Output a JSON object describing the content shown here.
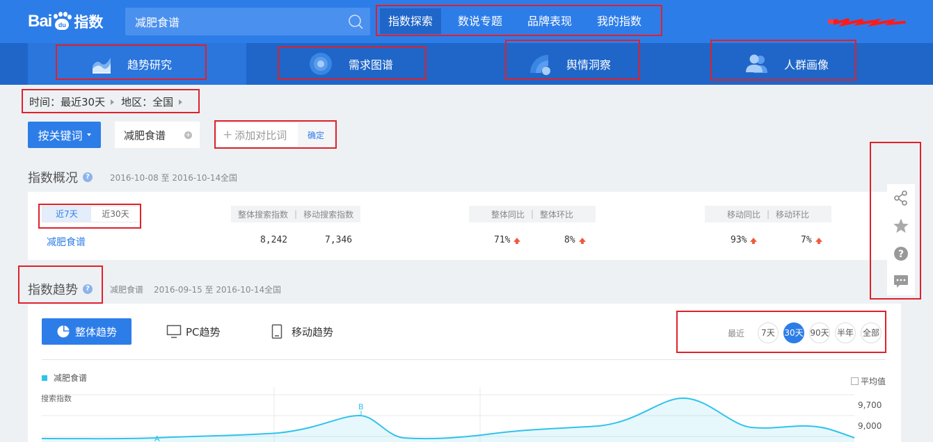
{
  "header": {
    "logo_bai": "Bai",
    "logo_du": "du",
    "logo_zh": "指数",
    "search_value": "减肥食谱",
    "nav": [
      {
        "label": "指数探索",
        "active": true
      },
      {
        "label": "数说专题",
        "active": false
      },
      {
        "label": "品牌表现",
        "active": false
      },
      {
        "label": "我的指数",
        "active": false
      }
    ]
  },
  "subnav": [
    {
      "label": "趋势研究",
      "icon": "trend-chart-icon",
      "active": true
    },
    {
      "label": "需求图谱",
      "icon": "target-circle-icon",
      "active": false
    },
    {
      "label": "舆情洞察",
      "icon": "signal-wave-icon",
      "active": false
    },
    {
      "label": "人群画像",
      "icon": "people-icon",
      "active": false
    }
  ],
  "filter": {
    "time_label": "时间：",
    "time_value": "最近30天",
    "region_label": "地区：",
    "region_value": "全国"
  },
  "keyword": {
    "mode_label": "按关键词",
    "tag": "减肥食谱",
    "add_compare": "添加对比词",
    "confirm": "确定"
  },
  "overview": {
    "title": "指数概况",
    "date_range": "2016-10-08 至 2016-10-14",
    "region": "全国",
    "range_tabs": [
      {
        "label": "近7天",
        "active": true
      },
      {
        "label": "近30天",
        "active": false
      }
    ],
    "col_search": [
      "整体搜索指数",
      "移动搜索指数"
    ],
    "col_yoy": [
      "整体同比",
      "整体环比"
    ],
    "col_mobile": [
      "移动同比",
      "移动环比"
    ],
    "row": {
      "keyword": "减肥食谱",
      "total_search": "8,242",
      "mobile_search": "7,346",
      "total_yoy": "71%",
      "total_mom": "8%",
      "mobile_yoy": "93%",
      "mobile_mom": "7%"
    }
  },
  "trend": {
    "title": "指数趋势",
    "keyword": "减肥食谱",
    "date_range": "2016-09-15 至 2016-10-14",
    "region": "全国",
    "tabs": [
      {
        "label": "整体趋势",
        "active": true
      },
      {
        "label": "PC趋势",
        "active": false
      },
      {
        "label": "移动趋势",
        "active": false
      }
    ],
    "period_label": "最近",
    "periods": [
      {
        "label": "7天",
        "active": false
      },
      {
        "label": "30天",
        "active": true
      },
      {
        "label": "90天",
        "active": false
      },
      {
        "label": "半年",
        "active": false
      },
      {
        "label": "全部",
        "active": false
      }
    ],
    "legend": "减肥食谱",
    "avg_label": "平均值",
    "ylabel": "搜索指数",
    "yticks": [
      "9,700",
      "9,000"
    ],
    "annotations": [
      "A",
      "B"
    ],
    "colors": {
      "line": "#2fc3ea",
      "accent": "#2d7de8"
    }
  },
  "side_tools": [
    "share-icon",
    "star-icon",
    "help-icon",
    "comment-icon"
  ]
}
